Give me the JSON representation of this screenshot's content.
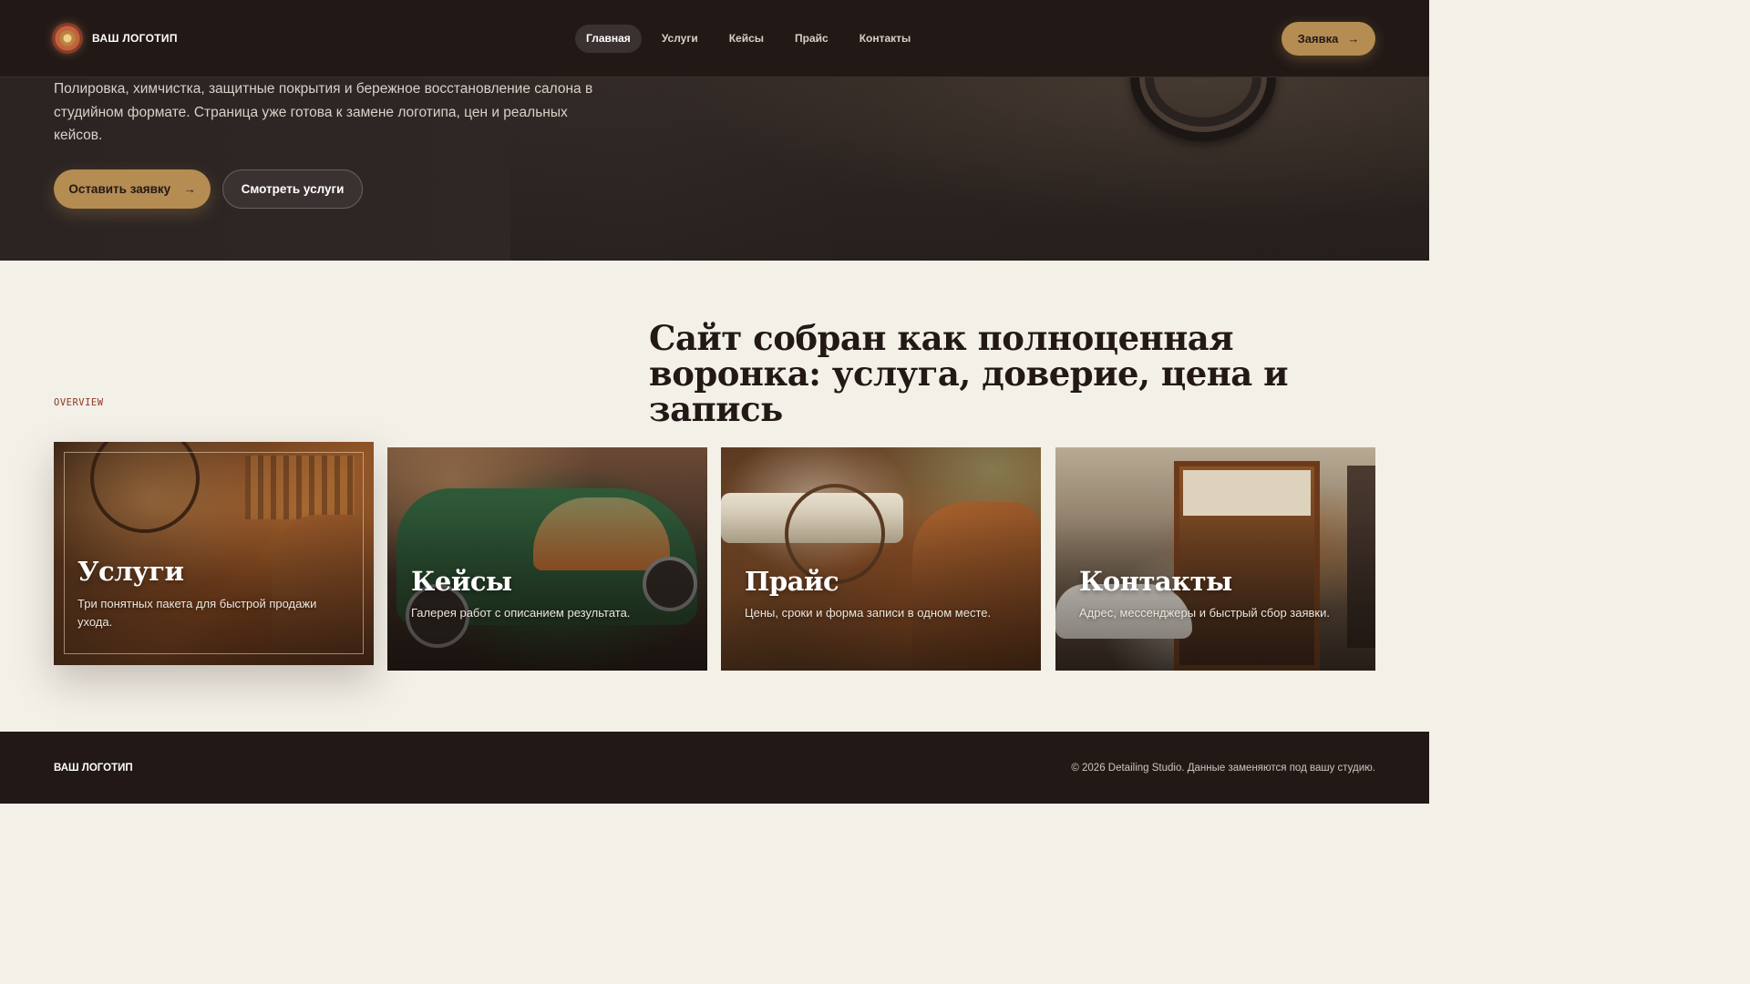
{
  "header": {
    "logo_text": "ВАШ ЛОГОТИП",
    "nav": [
      {
        "label": "Главная",
        "active": true
      },
      {
        "label": "Услуги",
        "active": false
      },
      {
        "label": "Кейсы",
        "active": false
      },
      {
        "label": "Прайс",
        "active": false
      },
      {
        "label": "Контакты",
        "active": false
      }
    ],
    "cta_label": "Заявка",
    "cta_arrow": "→"
  },
  "hero": {
    "text": "Полировка, химчистка, защитные покрытия и бережное восстановление салона в студийном формате. Страница уже готова к замене логотипа, цен и реальных кейсов.",
    "primary_button": "Оставить заявку",
    "primary_arrow": "→",
    "secondary_button": "Смотреть услуги"
  },
  "overview": {
    "label": "OVERVIEW",
    "title": "Сайт собран как полноценная воронка: услуга, доверие, цена и запись",
    "cards": [
      {
        "title": "Услуги",
        "description": "Три понятных пакета для быстрой продажи ухода.",
        "image": "leather-interior-workshop"
      },
      {
        "title": "Кейсы",
        "description": "Галерея работ с описанием результата.",
        "image": "green-classic-car-garage"
      },
      {
        "title": "Прайс",
        "description": "Цены, сроки и форма записи в одном месте.",
        "image": "classic-car-dashboard"
      },
      {
        "title": "Контакты",
        "description": "Адрес, мессенджеры и быстрый сбор заявки.",
        "image": "studio-storefront"
      }
    ]
  },
  "footer": {
    "logo_text": "ВАШ ЛОГОТИП",
    "copyright": "© 2026 Detailing Studio. Данные заменяются под вашу студию."
  },
  "colors": {
    "dark": "#221917",
    "accent": "#b58c52",
    "cream": "#f3f0e8",
    "label": "#8a3a25"
  }
}
